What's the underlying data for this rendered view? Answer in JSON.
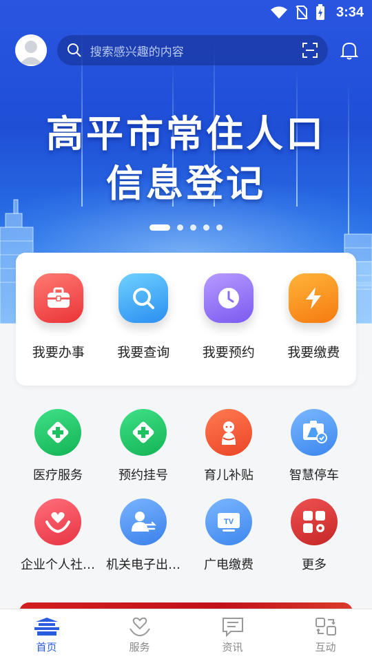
{
  "status_bar": {
    "time": "3:34"
  },
  "search": {
    "placeholder": "搜索感兴趣的内容"
  },
  "banner": {
    "line1": "高平市常住人口",
    "line2": "信息登记",
    "slides": 5,
    "active_slide": 1
  },
  "quick_actions": [
    {
      "label": "我要办事",
      "icon": "briefcase-icon",
      "color": "#f0474b"
    },
    {
      "label": "我要查询",
      "icon": "search-icon",
      "color": "#3fa3f0"
    },
    {
      "label": "我要预约",
      "icon": "clock-icon",
      "color": "#8f6ef2"
    },
    {
      "label": "我要缴费",
      "icon": "lightning-icon",
      "color": "#fb8a1c"
    }
  ],
  "services": [
    {
      "label": "医疗服务",
      "icon": "medical-cross-icon",
      "color": "#22c466"
    },
    {
      "label": "预约挂号",
      "icon": "medical-cross-icon",
      "color": "#22c466"
    },
    {
      "label": "育儿补贴",
      "icon": "baby-icon",
      "color": "#f2583a"
    },
    {
      "label": "智慧停车",
      "icon": "parking-icon",
      "color": "#4d9ef5"
    },
    {
      "label": "企业个人社…",
      "icon": "heart-hands-icon",
      "color": "#f04552"
    },
    {
      "label": "机关电子出…",
      "icon": "person-transfer-icon",
      "color": "#4f96f0"
    },
    {
      "label": "广电缴费",
      "icon": "tv-icon",
      "color": "#4f9ef0"
    },
    {
      "label": "更多",
      "icon": "grid-gear-icon",
      "color": "#d93434"
    }
  ],
  "bottom_nav": [
    {
      "label": "首页",
      "icon": "home-building-icon",
      "active": true
    },
    {
      "label": "服务",
      "icon": "heart-hand-icon",
      "active": false
    },
    {
      "label": "资讯",
      "icon": "news-chat-icon",
      "active": false
    },
    {
      "label": "互动",
      "icon": "interaction-icon",
      "active": false
    }
  ]
}
